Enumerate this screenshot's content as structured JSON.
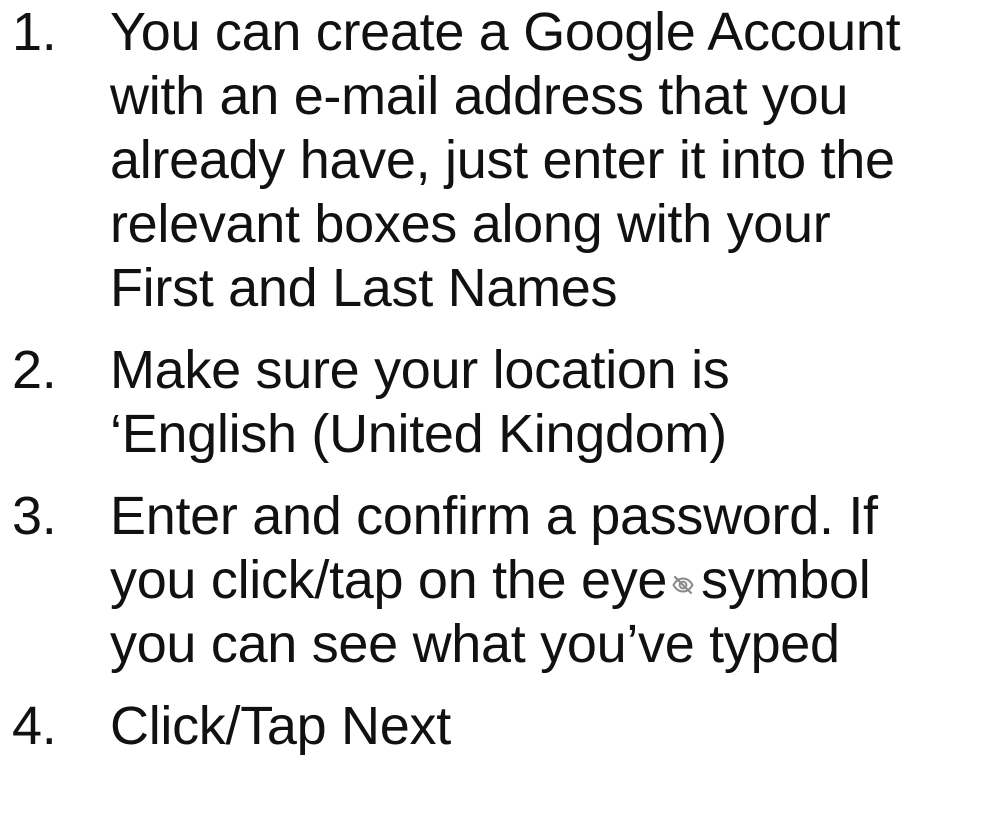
{
  "steps": [
    {
      "number": "1.",
      "lines": [
        "You can create a Google Account",
        "with an e-mail address that you",
        "already have, just enter it into the",
        "relevant boxes along with your",
        "First and Last Names"
      ]
    },
    {
      "number": "2.",
      "lines": [
        "Make sure your location is",
        "‘English (United Kingdom)"
      ]
    },
    {
      "number": "3.",
      "lines": [
        "Enter and confirm a password. If",
        "you click/tap on the eye",
        "symbol",
        "you can see what you’ve typed"
      ],
      "icon": "eye-off-icon"
    },
    {
      "number": "4.",
      "lines": [
        "Click/Tap Next"
      ]
    }
  ]
}
